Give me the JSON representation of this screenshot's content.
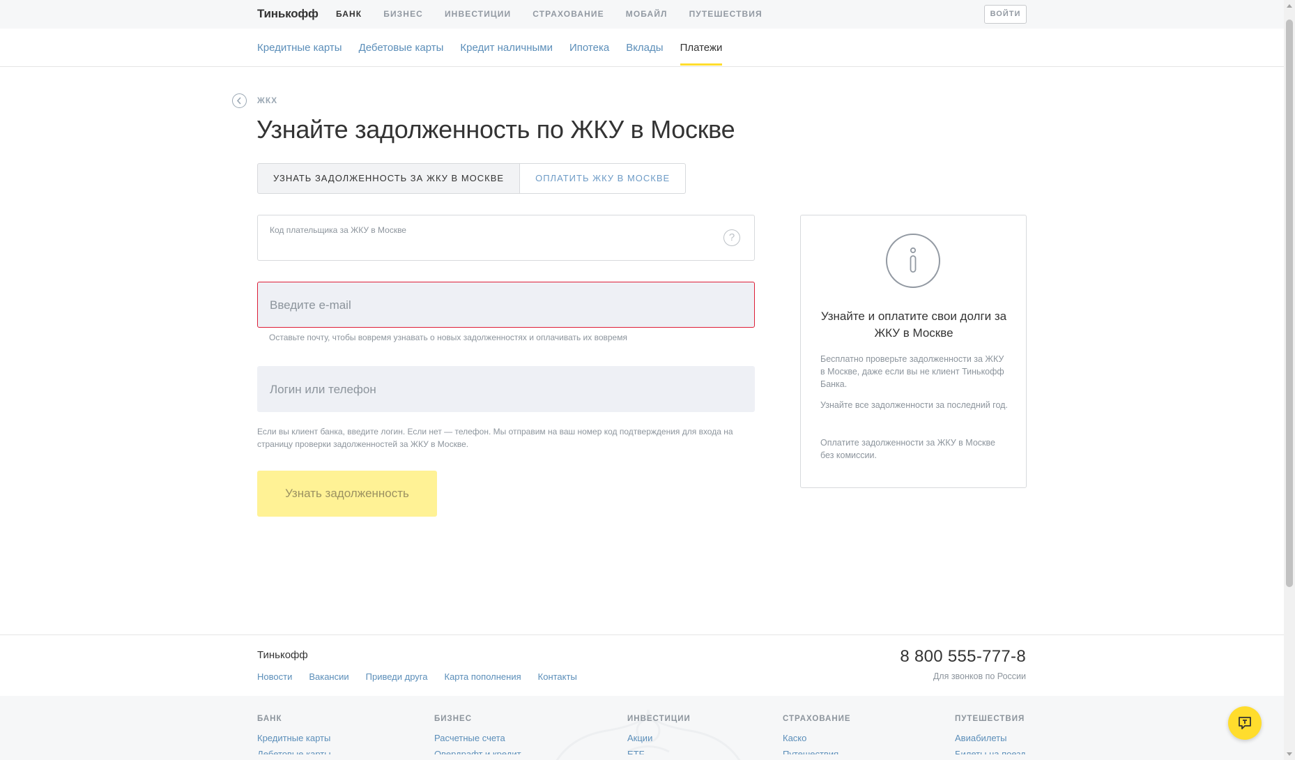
{
  "header": {
    "logo": "Тинькофф",
    "nav": [
      "БАНК",
      "БИЗНЕС",
      "ИНВЕСТИЦИИ",
      "СТРАХОВАНИЕ",
      "МОБАЙЛ",
      "ПУТЕШЕСТВИЯ"
    ],
    "active_nav": "БАНК",
    "login_label": "ВОЙТИ"
  },
  "subnav": {
    "items": [
      "Кредитные карты",
      "Дебетовые карты",
      "Кредит наличными",
      "Ипотека",
      "Вклады",
      "Платежи"
    ],
    "active": "Платежи"
  },
  "breadcrumb": {
    "back_label": "ЖКХ",
    "icon": "chevron-left-icon"
  },
  "page_title": "Узнайте задолженность по ЖКУ в Москве",
  "tabs": [
    {
      "label": "Узнать задолженность за ЖКУ в Москве",
      "active": true
    },
    {
      "label": "Оплатить ЖКУ в Москве",
      "active": false
    }
  ],
  "form": {
    "payer_code": {
      "label": "Код плательщика за ЖКУ в Москве",
      "value": "",
      "help_icon": "question-icon"
    },
    "email": {
      "placeholder": "Введите e-mail",
      "value": "",
      "hint": "Оставьте почту, чтобы вовремя узнавать о новых задолженностях и оплачивать их вовремя",
      "state": "error"
    },
    "login": {
      "placeholder": "Логин или телефон",
      "value": "",
      "hint": "Если вы клиент банка, введите логин. Если нет — телефон. Мы отправим на ваш номер код подтверждения для входа на страницу проверки задолженностей за ЖКУ в Москве."
    },
    "submit_label": "Узнать задолженность"
  },
  "info_card": {
    "icon": "info-icon",
    "title": "Узнайте и оплатите свои долги за ЖКУ в Москве",
    "paragraphs": [
      "Бесплатно проверьте задолженности за ЖКУ в Москве, даже если вы не клиент Тинькофф Банка.",
      "Узнайте все задолженности за последний год.",
      "Оплатите задолженности за ЖКУ в Москве без комиссии."
    ]
  },
  "footer": {
    "brand": "Тинькофф",
    "links": [
      "Новости",
      "Вакансии",
      "Приведи друга",
      "Карта пополнения",
      "Контакты"
    ],
    "phone": "8 800 555-777-8",
    "phone_note": "Для звонков по России",
    "columns": [
      {
        "title": "БАНК",
        "items": [
          "Кредитные карты",
          "Дебетовые карты"
        ]
      },
      {
        "title": "БИЗНЕС",
        "items": [
          "Расчетные счета",
          "Овердрафт и кредит"
        ]
      },
      {
        "title": "ИНВЕСТИЦИИ",
        "items": [
          "Акции",
          "ETF"
        ]
      },
      {
        "title": "СТРАХОВАНИЕ",
        "items": [
          "Каско",
          "Путешествия"
        ]
      },
      {
        "title": "ПУТЕШЕСТВИЯ",
        "items": [
          "Авиабилеты",
          "Билеты на поезд"
        ]
      }
    ]
  },
  "chat": {
    "icon": "chat-icon"
  },
  "colors": {
    "brand_yellow": "#ffdd2d",
    "link_blue": "#5b8eb9",
    "error_red": "#dd1d36",
    "button_disabled": "#fff295"
  }
}
